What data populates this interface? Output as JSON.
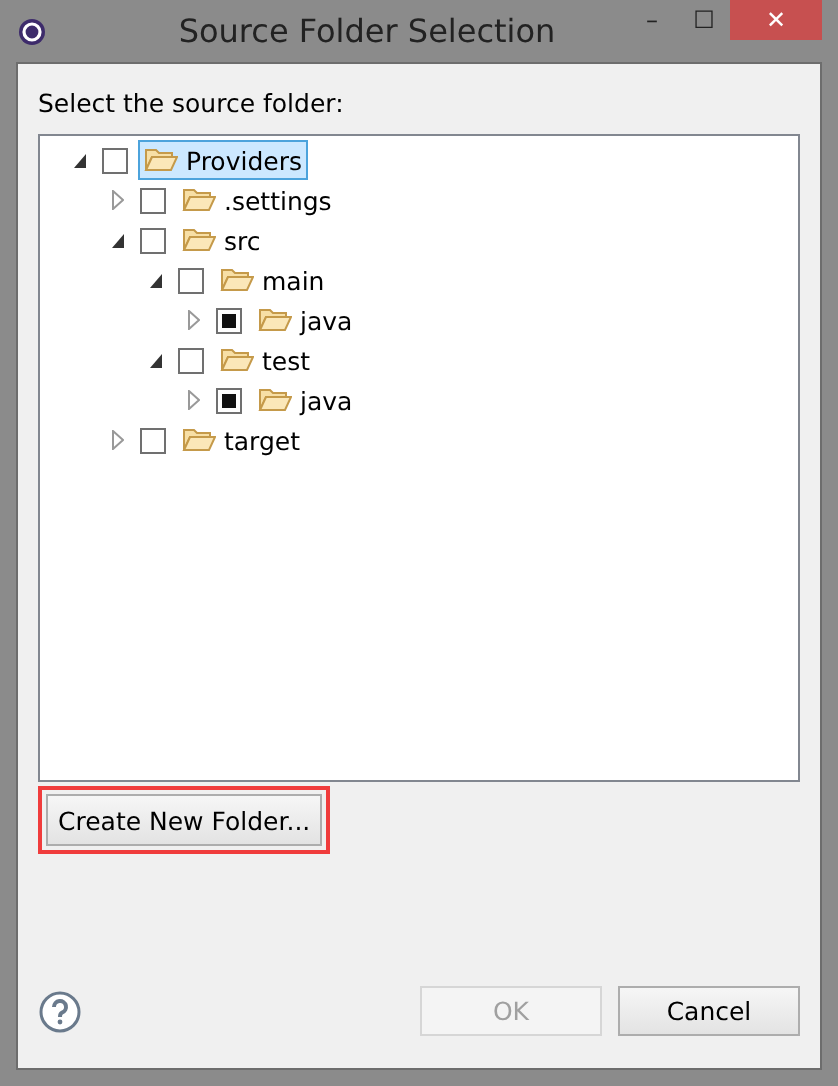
{
  "window": {
    "title": "Source Folder Selection",
    "buttons": [
      "–",
      "☐",
      "✕"
    ]
  },
  "prompt": "Select the source folder:",
  "tree": [
    {
      "label": "Providers",
      "expanded": true,
      "partial": false,
      "selected": true,
      "children": [
        {
          "label": ".settings",
          "expanded": false,
          "partial": false,
          "selected": false
        },
        {
          "label": "src",
          "expanded": true,
          "partial": false,
          "selected": false,
          "children": [
            {
              "label": "main",
              "expanded": true,
              "partial": false,
              "selected": false,
              "children": [
                {
                  "label": "java",
                  "expanded": false,
                  "partial": true,
                  "selected": false
                }
              ]
            },
            {
              "label": "test",
              "expanded": true,
              "partial": false,
              "selected": false,
              "children": [
                {
                  "label": "java",
                  "expanded": false,
                  "partial": true,
                  "selected": false
                }
              ]
            }
          ]
        },
        {
          "label": "target",
          "expanded": false,
          "partial": false,
          "selected": false
        }
      ]
    }
  ],
  "create_button": {
    "label": "Create New Folder...",
    "highlighted": true
  },
  "footer_buttons": [
    {
      "label": "OK",
      "disabled": true
    },
    {
      "label": "Cancel",
      "disabled": false
    }
  ]
}
